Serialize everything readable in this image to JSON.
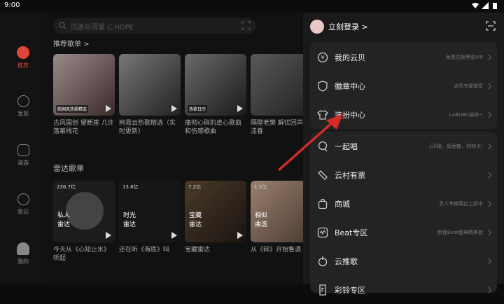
{
  "status_bar": {
    "time": "9:00"
  },
  "nav": {
    "items": [
      {
        "label": "推荐",
        "icon": "recommend-icon"
      },
      {
        "label": "发现",
        "icon": "discover-icon"
      },
      {
        "label": "漫游",
        "icon": "roam-icon"
      },
      {
        "label": "笔记",
        "icon": "notes-icon"
      },
      {
        "label": "我的",
        "icon": "profile-icon"
      }
    ]
  },
  "search": {
    "placeholder": "沉迷与溺爱 C.HOPE"
  },
  "playlists": {
    "title": "推荐歌单 >",
    "items": [
      {
        "tag": "韵国风热歌精选",
        "caption": "古风国创 望断崖 几许落幕残花"
      },
      {
        "tag": "",
        "caption": "网易云热歌精选（实时更新）"
      },
      {
        "tag": "热歌日历",
        "caption": "痛彻心碎的虐心歌曲和伤感歌曲"
      },
      {
        "tag": "",
        "caption": "隔壁老樊 解忧回声 木洼春"
      }
    ]
  },
  "radar": {
    "title": "雷达歌单",
    "items": [
      {
        "count": "226.7亿",
        "label": "私人\n雷达",
        "caption": "今天从《心知止水》听起"
      },
      {
        "count": "13.6亿",
        "label": "时光\n雷达",
        "caption": "还在听《海底》吗"
      },
      {
        "count": "7.2亿",
        "label": "宝藏\n雷达",
        "caption": "宝藏雷达"
      },
      {
        "count": "1.2亿",
        "label": "相似\n曲选",
        "caption": "从《碎》开始鲁源"
      }
    ]
  },
  "panel": {
    "login": "立刻登录 >",
    "group1": [
      {
        "label": "我的云贝",
        "right": "免费兑换黑胶VIP",
        "icon": "cloud-coin-icon"
      },
      {
        "label": "徽章中心",
        "right": "点亮专属徽章",
        "icon": "badge-icon"
      },
      {
        "label": "装扮中心",
        "right": "LABUBU装扮~",
        "icon": "tshirt-icon"
      }
    ],
    "group2": [
      {
        "label": "一起唱",
        "right": "云K歌、假面散、购物卡!",
        "icon": "mic-icon"
      },
      {
        "label": "云村有票",
        "right": "",
        "icon": "ticket-icon"
      },
      {
        "label": "商城",
        "right": "艺人专辑周边上新中",
        "icon": "shop-bag-icon"
      },
      {
        "label": "Beat专区",
        "right": "新春Beat盛典精美掀",
        "icon": "beat-icon"
      },
      {
        "label": "云推歌",
        "right": "",
        "icon": "push-song-icon"
      },
      {
        "label": "彩铃专区",
        "right": "",
        "icon": "ringtone-icon"
      }
    ]
  },
  "colors": {
    "accent": "#e0453a",
    "annotation_arrow": "#d42a2a"
  }
}
